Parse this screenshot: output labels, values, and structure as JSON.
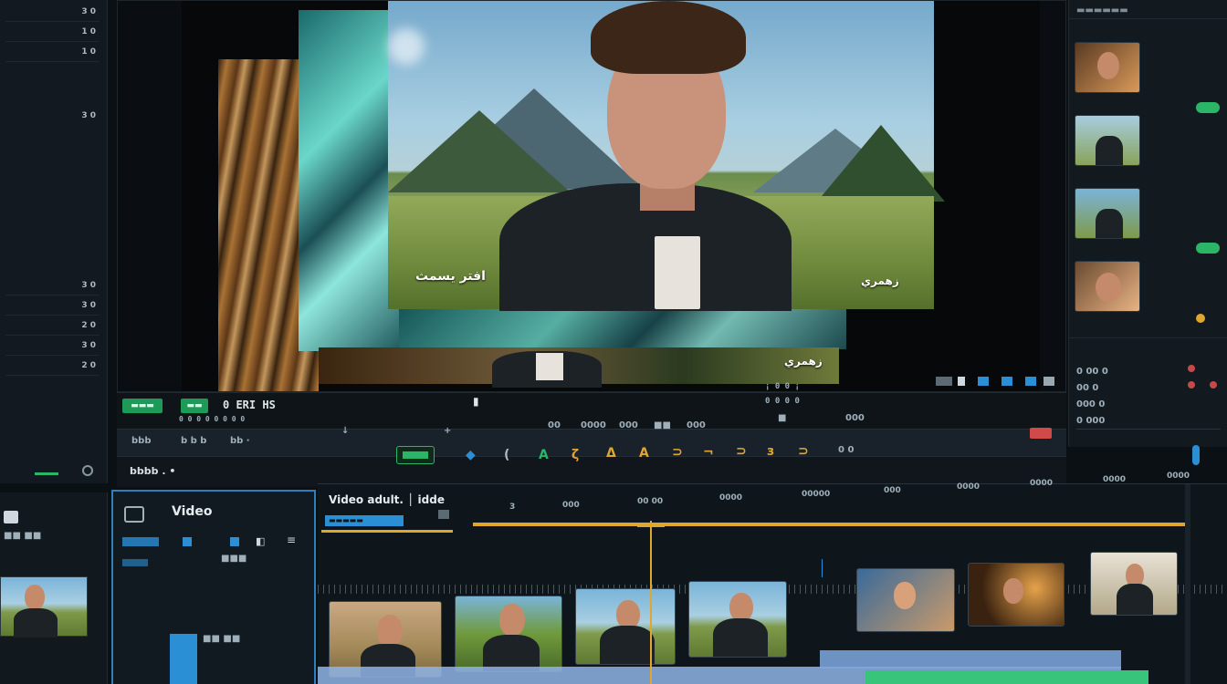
{
  "left_column": {
    "rows": [
      "3 0",
      "1 0",
      "1 0",
      "3 0",
      "3 0",
      "3 0",
      "2 0",
      "3 0",
      "2 0"
    ],
    "footer_label": "▬"
  },
  "viewer": {
    "subtitle_left": "افتر يسمث",
    "subtitle_right": "زهمري",
    "lower_caption": "زهمري"
  },
  "transport": {
    "left_btn_1": "▬▬▬",
    "left_btn_2": "▬▬",
    "timecode": "0  ERI  HS",
    "sub_timecode": "0 0   0 0   0 0   0 0",
    "center_mark": "▮",
    "right_mark": "¡ 0 0 ¡",
    "right_sub": "0 0 0 0"
  },
  "toolbar": {
    "items": [
      "bbb",
      "b b b",
      "bb ·",
      "↓",
      "+",
      "00",
      "0000",
      "000",
      "■■",
      "000",
      "■",
      "000"
    ]
  },
  "tools": {
    "status_label": "bbbb . •",
    "icons": [
      "◆",
      "(",
      "A",
      "ζ",
      "Δ",
      "A",
      "⊃",
      "¬",
      "⊃",
      "з",
      "⊃",
      "⊂"
    ],
    "right_label": "0 0"
  },
  "right_panel": {
    "header": "▬▬▬▬▬▬",
    "labels": [
      "0 00 0",
      "00 0",
      "000 0",
      "0 000"
    ]
  },
  "bottom_left": {
    "title": "Video",
    "sub_label": "■■ ■■",
    "item_label": "■■■"
  },
  "timeline": {
    "title": "Video adult. │ idde",
    "marker_label": "▬▬▬▬▬",
    "times": [
      "3",
      "000",
      "00 00",
      "0000",
      "00000",
      "000",
      "0000",
      "0000",
      "0000",
      "0000"
    ]
  }
}
